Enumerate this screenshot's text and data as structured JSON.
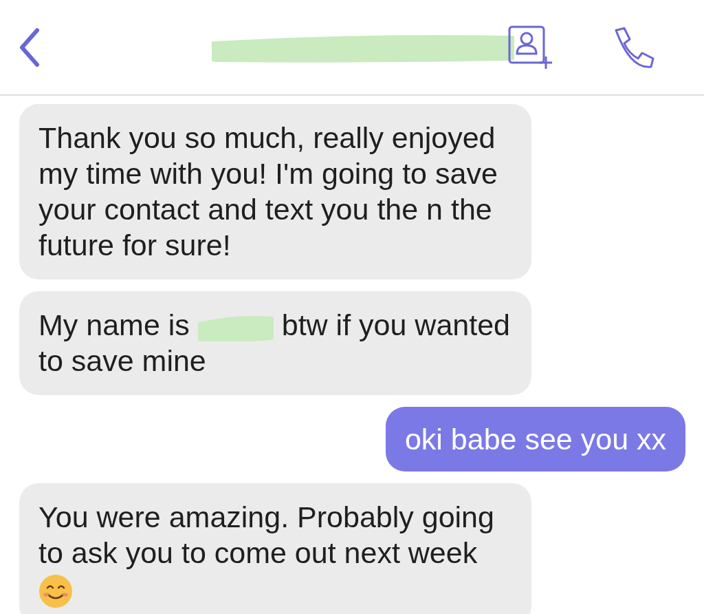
{
  "header": {
    "title": {
      "kind": "redacted"
    }
  },
  "messages": [
    {
      "kind": "received",
      "parts": [
        {
          "kind": "text",
          "text": "Thank you so much, really enjoyed my time with you! I'm going to save your contact and text you the n the future for sure!"
        }
      ]
    },
    {
      "kind": "received",
      "parts": [
        {
          "kind": "text",
          "text": "My name is"
        },
        {
          "kind": "redacted"
        },
        {
          "kind": "text",
          "text": "btw if you wanted"
        },
        {
          "kind": "text",
          "text": "to save mine"
        }
      ]
    },
    {
      "kind": "sent",
      "parts": [
        {
          "kind": "text",
          "text": "oki babe see you xx"
        }
      ]
    },
    {
      "kind": "received",
      "parts": [
        {
          "kind": "text",
          "text": "You were amazing. Probably going to ask you to come out next week"
        },
        {
          "kind": "emoji"
        }
      ]
    }
  ]
}
